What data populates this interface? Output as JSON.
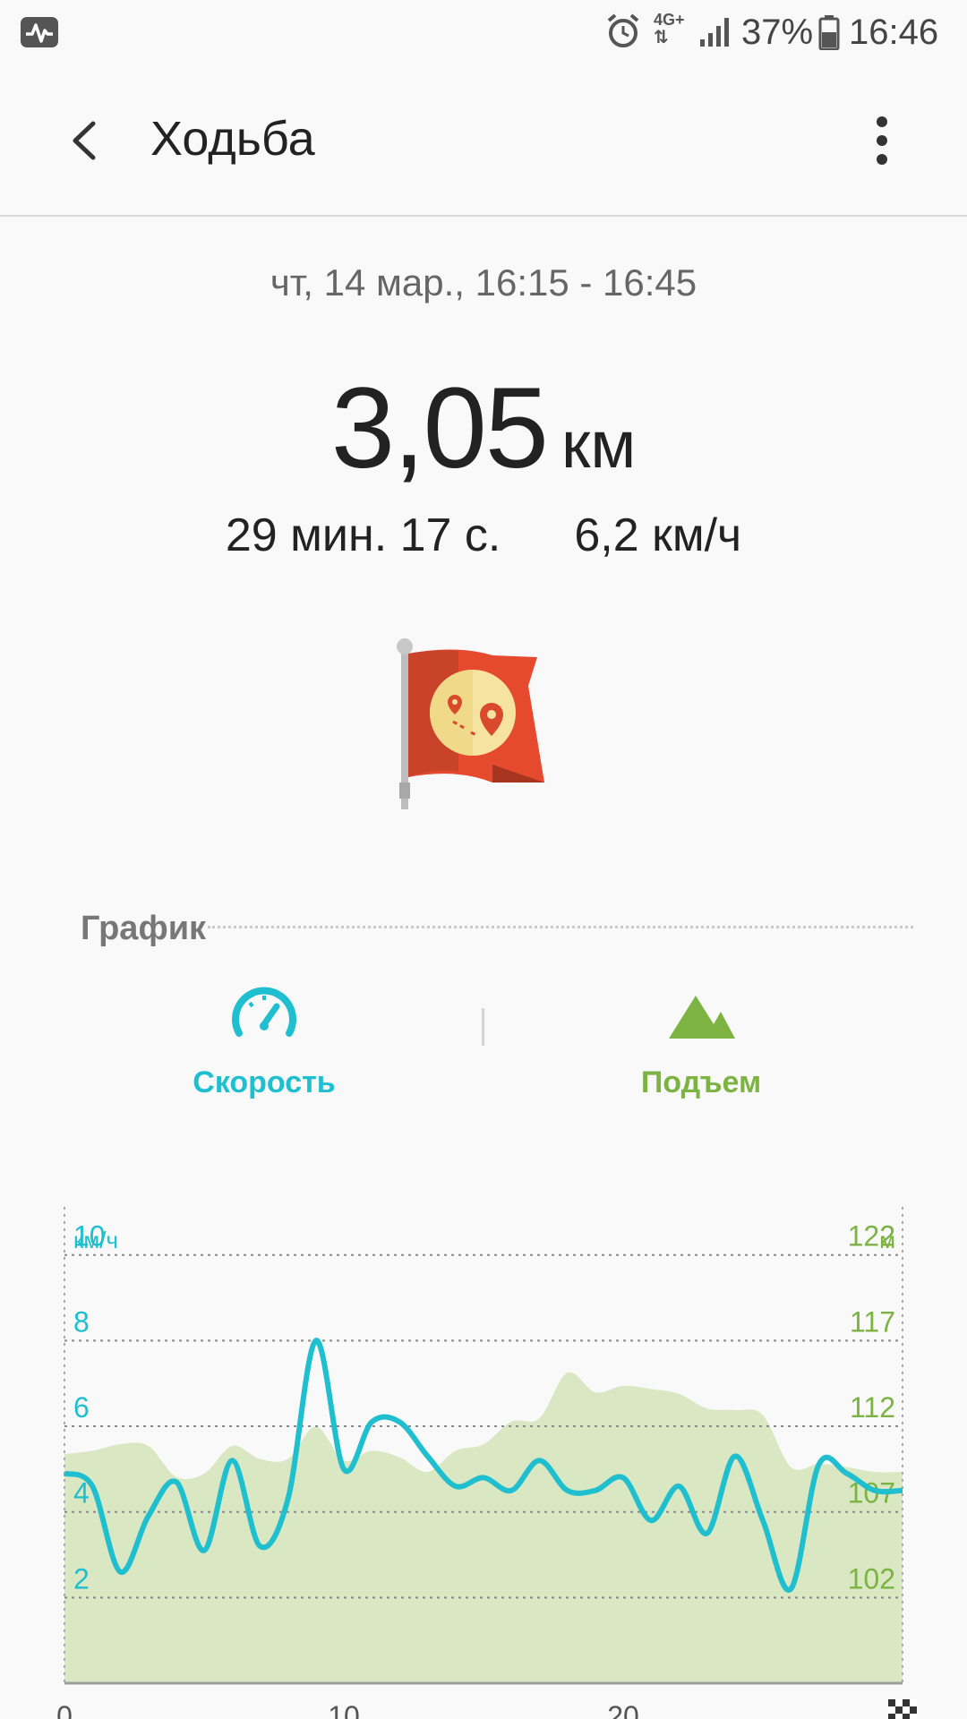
{
  "status_bar": {
    "network": "4G+",
    "battery": "37%",
    "time": "16:46"
  },
  "app_bar": {
    "title": "Ходьба",
    "back_icon": "back-arrow-icon",
    "more_icon": "more-vert-icon"
  },
  "summary": {
    "date_time": "чт, 14 мар., 16:15 - 16:45",
    "distance_value": "3,05",
    "distance_unit": "км",
    "duration": "29 мин. 17 с.",
    "avg_speed": "6,2 км/ч"
  },
  "graph_section": {
    "title": "График",
    "tabs": [
      {
        "label": "Скорость",
        "icon": "speedometer-icon",
        "color": "#1fbfcf"
      },
      {
        "label": "Подъем",
        "icon": "mountain-icon",
        "color": "#7cb342"
      }
    ]
  },
  "chart_data": {
    "type": "line",
    "left_axis": {
      "unit": "км/ч",
      "ticks": [
        "10",
        "8",
        "6",
        "4",
        "2"
      ],
      "range": [
        0,
        11.5
      ]
    },
    "right_axis": {
      "unit": "м",
      "ticks": [
        "122",
        "117",
        "112",
        "107",
        "102"
      ],
      "range": [
        95.7,
        126
      ]
    },
    "x_ticks": [
      "0",
      "10",
      "20"
    ],
    "x_range": [
      0,
      30
    ],
    "series": [
      {
        "x": [
          0,
          1,
          2,
          3,
          4,
          5,
          6,
          7,
          8,
          9,
          10,
          11,
          12,
          13,
          14,
          15,
          16,
          17,
          18,
          19,
          20,
          21,
          22,
          23,
          24,
          25,
          26,
          27,
          28,
          29,
          30
        ],
        "values": [
          4.9,
          4.6,
          2.6,
          3.9,
          4.7,
          3.1,
          5.2,
          3.2,
          4.3,
          8.0,
          5.0,
          6.1,
          6.1,
          5.3,
          4.6,
          4.8,
          4.5,
          5.2,
          4.5,
          4.5,
          4.8,
          3.8,
          4.6,
          3.5,
          5.3,
          3.8,
          2.2,
          5.1,
          4.9,
          4.5,
          4.5
        ],
        "color": "#1fbfcf"
      },
      {
        "x": [
          0,
          1,
          2,
          3,
          4,
          5,
          6,
          7,
          8,
          9,
          10,
          11,
          12,
          13,
          14,
          15,
          16,
          17,
          18,
          19,
          20,
          21,
          22,
          23,
          24,
          25,
          26,
          27,
          28,
          29,
          30
        ],
        "values": [
          109.8,
          110.0,
          110.4,
          110.3,
          108.4,
          108.6,
          110.3,
          109.5,
          109.5,
          111.5,
          109.4,
          110.0,
          109.6,
          108.7,
          110.0,
          110.4,
          111.8,
          112.0,
          114.8,
          113.6,
          114.0,
          113.8,
          113.5,
          112.6,
          112.5,
          112.2,
          109.0,
          109.2,
          109.0,
          108.7,
          108.7
        ],
        "color": "#d9e8c3"
      }
    ],
    "grid": true
  }
}
